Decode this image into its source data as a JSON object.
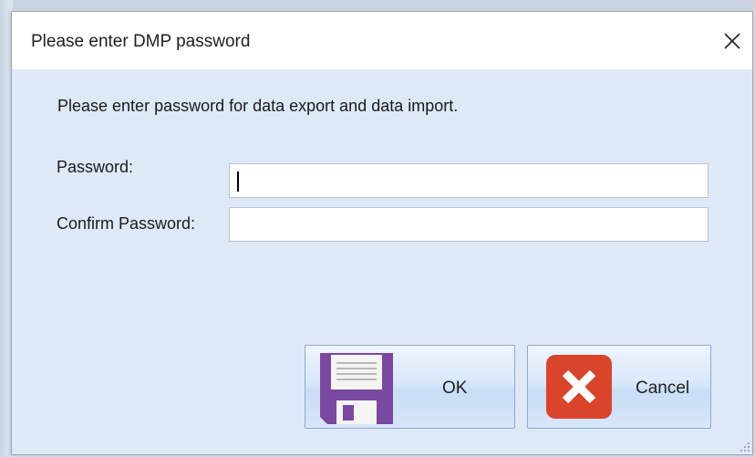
{
  "dialog": {
    "title": "Please enter DMP password",
    "instruction": "Please enter password for data export and data import."
  },
  "form": {
    "password_label": "Password:",
    "password_value": "",
    "confirm_label": "Confirm Password:",
    "confirm_value": ""
  },
  "buttons": {
    "ok_label": "OK",
    "cancel_label": "Cancel"
  },
  "icons": {
    "close": "close-icon",
    "ok": "floppy-disk-icon",
    "cancel": "x-icon"
  },
  "colors": {
    "client_background": "#dee9f8",
    "floppy": "#7a48a0",
    "cancel_icon": "#d9442a"
  }
}
